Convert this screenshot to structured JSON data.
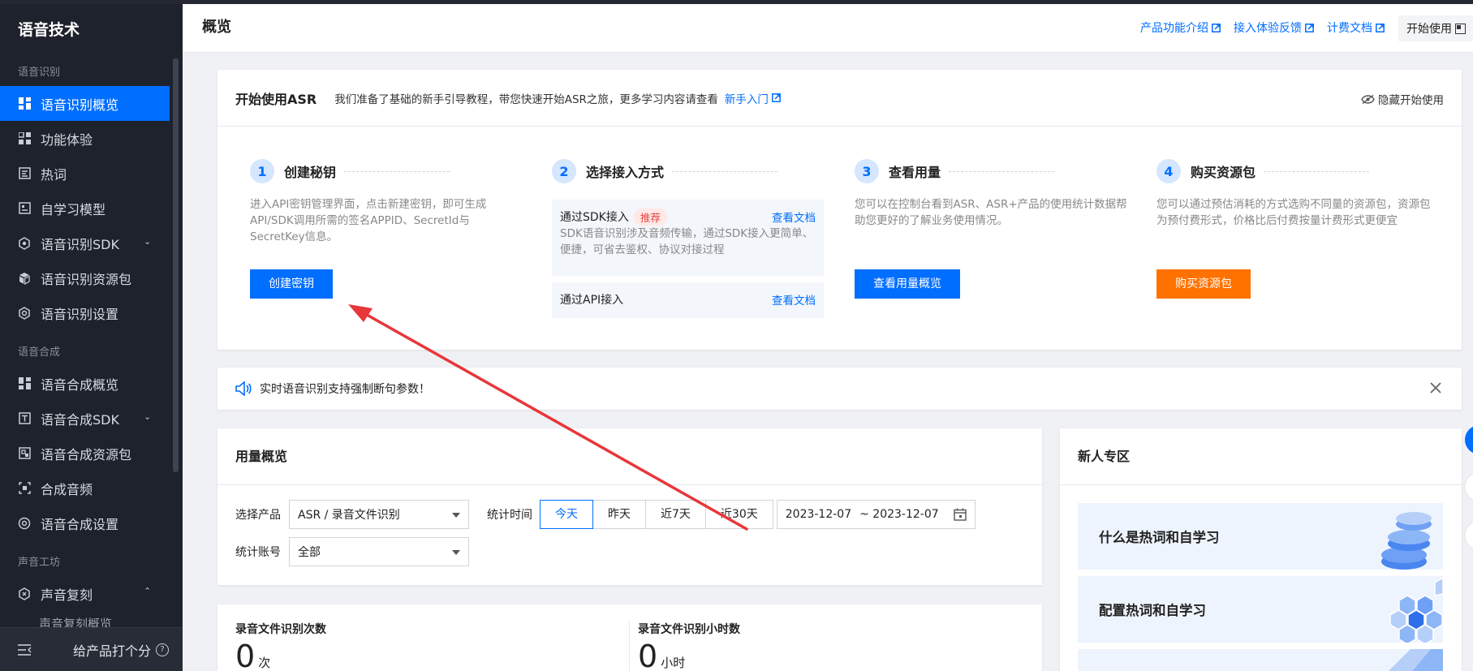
{
  "sidebar": {
    "title": "语音技术",
    "groups": [
      {
        "label": "语音识别"
      },
      {
        "label": "语音合成"
      },
      {
        "label": "声音工坊"
      }
    ],
    "items": [
      {
        "label": "语音识别概览",
        "icon": "dashboard-icon",
        "active": true
      },
      {
        "label": "功能体验",
        "icon": "apps-icon"
      },
      {
        "label": "热词",
        "icon": "hotword-icon"
      },
      {
        "label": "自学习模型",
        "icon": "model-icon"
      },
      {
        "label": "语音识别SDK",
        "icon": "sdk-icon"
      },
      {
        "label": "语音识别资源包",
        "icon": "package-icon"
      },
      {
        "label": "语音识别设置",
        "icon": "settings-icon"
      },
      {
        "label": "语音合成概览",
        "icon": "dashboard-icon"
      },
      {
        "label": "语音合成SDK",
        "icon": "text-icon"
      },
      {
        "label": "语音合成资源包",
        "icon": "package-icon"
      },
      {
        "label": "合成音频",
        "icon": "audio-icon"
      },
      {
        "label": "语音合成设置",
        "icon": "settings-icon"
      },
      {
        "label": "声音复刻",
        "icon": "clone-icon"
      },
      {
        "label": "声音复刻概览"
      }
    ],
    "footer": {
      "rate_label": "给产品打个分"
    }
  },
  "header": {
    "title": "概览",
    "links": [
      "产品功能介绍",
      "接入体验反馈",
      "计费文档"
    ],
    "start_label": "开始使用"
  },
  "start": {
    "title": "开始使用ASR",
    "desc": "我们准备了基础的新手引导教程，带您快速开始ASR之旅，更多学习内容请查看",
    "guide_link": "新手入门",
    "hide_label": "隐藏开始使用",
    "steps": [
      {
        "num": "1",
        "title": "创建秘钥",
        "desc": "进入API密钥管理界面，点击新建密钥，即可生成API/SDK调用所需的签名APPID、SecretId与SecretKey信息。",
        "button": "创建密钥"
      },
      {
        "num": "2",
        "title": "选择接入方式"
      },
      {
        "num": "3",
        "title": "查看用量",
        "desc": "您可以在控制台看到ASR、ASR+产品的使用统计数据帮助您更好的了解业务使用情况。",
        "button": "查看用量概览"
      },
      {
        "num": "4",
        "title": "购买资源包",
        "desc": "您可以通过预估消耗的方式选购不同量的资源包，资源包为预付费形式，价格比后付费按量计费形式更便宜",
        "button": "购买资源包"
      }
    ],
    "ways": {
      "sdk_label": "通过SDK接入",
      "sdk_tag": "推荐",
      "sdk_desc": "SDK语音识别涉及音频传输，通过SDK接入更简单、便捷，可省去鉴权、协议对接过程",
      "api_label": "通过API接入",
      "doc_link": "查看文档"
    }
  },
  "notice": {
    "text": "实时语音识别支持强制断句参数！"
  },
  "usage": {
    "title": "用量概览",
    "product_label": "选择产品",
    "product_value": "ASR / 录音文件识别",
    "time_label": "统计时间",
    "ranges": [
      "今天",
      "昨天",
      "近7天",
      "近30天"
    ],
    "date_from": "2023-12-07",
    "date_to": "~ 2023-12-07",
    "account_label": "统计账号",
    "account_value": "全部"
  },
  "newbie": {
    "title": "新人专区",
    "items": [
      "什么是热词和自学习",
      "配置热词和自学习"
    ]
  },
  "stats": [
    {
      "label": "录音文件识别次数",
      "value": "0",
      "unit": "次"
    },
    {
      "label": "录音文件识别小时数",
      "value": "0",
      "unit": "小时"
    }
  ],
  "colors": {
    "primary": "#006eff",
    "orange": "#ff7200",
    "sidebar": "#1e222d",
    "annotation": "#e8363a"
  }
}
